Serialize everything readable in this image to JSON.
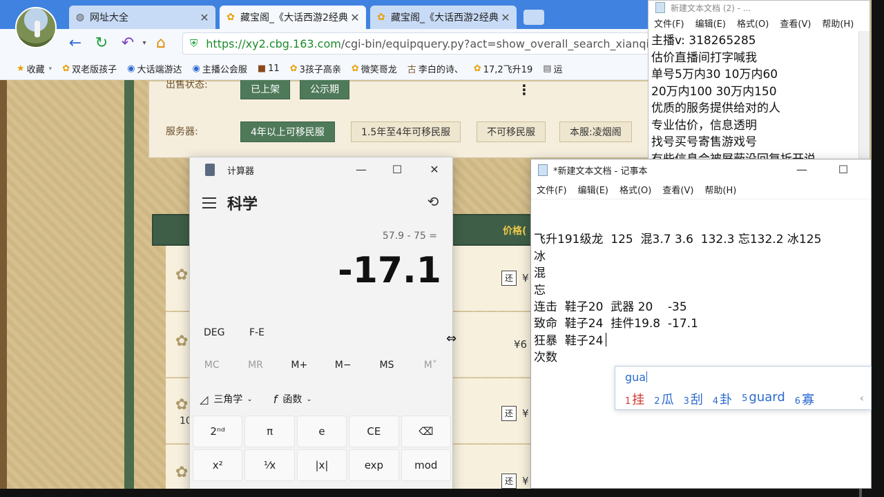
{
  "browser": {
    "tabs": [
      {
        "label": "网址大全",
        "icon": "globe-icon"
      },
      {
        "label": "藏宝阁_《大话西游2经典",
        "icon": "chick-icon"
      },
      {
        "label": "藏宝阁_《大话西游2经典",
        "icon": "chick-icon"
      }
    ],
    "close_glyph": "✕",
    "url_domain": "https://xy2.cbg.163.com",
    "url_path": "/cgi-bin/equipquery.py?act=show_overall_search_xianqi",
    "bookmarks": [
      {
        "label": "收藏",
        "icon": "star-icon"
      },
      {
        "label": "双老版孩子"
      },
      {
        "label": "大话端游达"
      },
      {
        "label": "主播公会服"
      },
      {
        "label": "11"
      },
      {
        "label": "3孩子高亲"
      },
      {
        "label": "微笑哥龙"
      },
      {
        "label": "李白的诗、"
      },
      {
        "label": "17,2飞升19"
      },
      {
        "label": "运"
      }
    ]
  },
  "page": {
    "status_label": "出售状态:",
    "status_options": [
      "已上架",
      "公示期"
    ],
    "server_label": "服务器:",
    "server_options": [
      "4年以上可移民服",
      "1.5年至4年可移民服",
      "不可移民服",
      "本服:凌烟阁"
    ],
    "price_header": "价格(",
    "rows": [
      {
        "tag": "还",
        "price": "¥"
      },
      {
        "tag": "",
        "price": "¥6"
      },
      {
        "tag": "还",
        "price": "¥",
        "num": "10"
      },
      {
        "tag": "还",
        "price": "¥"
      }
    ]
  },
  "calculator": {
    "title": "计算器",
    "mode": "科学",
    "expression": "57.9 - 75 =",
    "result": "-17.1",
    "deg": "DEG",
    "fe": "F-E",
    "memory": [
      "MC",
      "MR",
      "M+",
      "M−",
      "MS",
      "M˅"
    ],
    "trig": "三角学",
    "func": "函数",
    "buttons": [
      "2ⁿᵈ",
      "π",
      "e",
      "CE",
      "⌫",
      "x²",
      "¹⁄x",
      "|x|",
      "exp",
      "mod"
    ]
  },
  "notepad_top": {
    "title": "新建文本文档 (2) - ...",
    "menu": [
      "文件(F)",
      "编辑(E)",
      "格式(O)",
      "查看(V)",
      "帮助(H)"
    ],
    "lines": [
      "主播v:  318265285",
      "估价直播间打字喊我",
      "单号5万内30 10万内60",
      "20万内100 30万内150",
      "优质的服务提供给对的人",
      "专业估价，信息透明",
      "找号买号寄售游戏号",
      "有些信息会被屏蔽没回复拆开说"
    ]
  },
  "notepad": {
    "title": "*新建文本文档 - 记事本",
    "menu": [
      "文件(F)",
      "编辑(E)",
      "格式(O)",
      "查看(V)",
      "帮助(H)"
    ],
    "lines": [
      "飞升191级龙  125  混3.7 3.6  132.3 忘132.2 冰125",
      "",
      "冰",
      "混",
      "忘",
      "",
      "连击  鞋子20  武器 20    -35",
      "致命  鞋子24  挂件19.8  -17.1",
      "狂暴  鞋子24",
      "次数"
    ]
  },
  "ime": {
    "input": "gua",
    "candidates": [
      {
        "n": "1",
        "text": "挂"
      },
      {
        "n": "2",
        "text": "瓜"
      },
      {
        "n": "3",
        "text": "刮"
      },
      {
        "n": "4",
        "text": "卦"
      },
      {
        "n": "5",
        "text": "guard"
      },
      {
        "n": "6",
        "text": "寡"
      }
    ],
    "arrow": "‹"
  }
}
